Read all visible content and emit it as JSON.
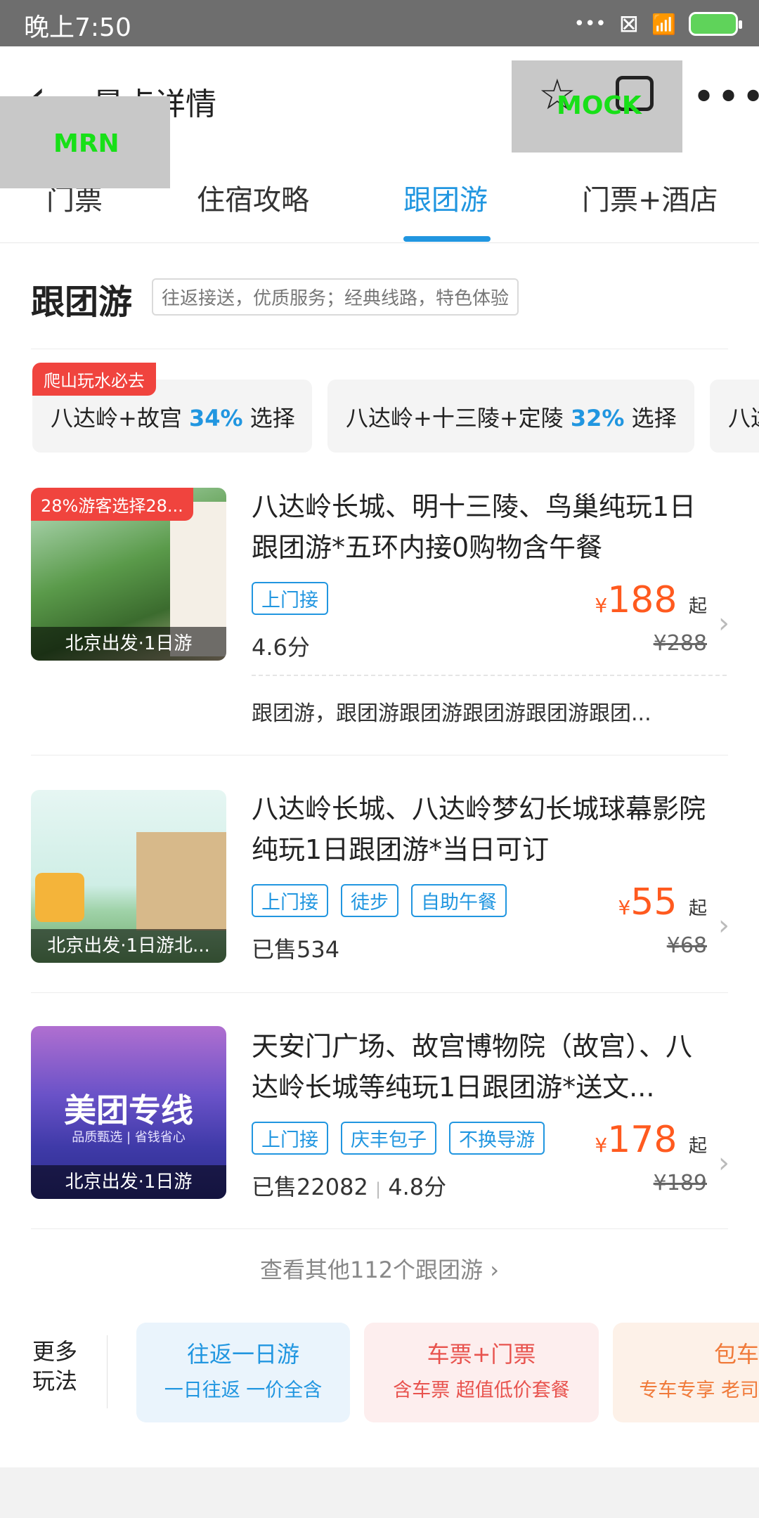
{
  "status_bar": {
    "time": "晚上7:50",
    "icons": [
      "dots-icon",
      "close-box-icon",
      "wifi-icon",
      "battery-charging-icon"
    ],
    "dots": "•••",
    "close": "⊠",
    "wifi": "📶"
  },
  "header": {
    "back_glyph": "‹",
    "title": "景点详情",
    "mock_label": "MOCK",
    "mrn_label": "MRN",
    "star_glyph": "☆",
    "more_glyph": "•••"
  },
  "tabs": [
    {
      "label": "门票"
    },
    {
      "label": "住宿攻略"
    },
    {
      "label": "跟团游",
      "active": true
    },
    {
      "label": "门票+酒店"
    }
  ],
  "section": {
    "title": "跟团游",
    "desc": "往返接送，优质服务；经典线路，特色体验"
  },
  "chips": [
    {
      "tag": "爬山玩水必去",
      "name": "八达岭+故宫",
      "pct": "34%",
      "suffix": "选择"
    },
    {
      "name": "八达岭+十三陵+定陵",
      "pct": "32%",
      "suffix": "选择"
    },
    {
      "name": "八达"
    }
  ],
  "products": [
    {
      "badge": "28%游客选择28...",
      "caption": "北京出发·1日游",
      "title": "八达岭长城、明十三陵、鸟巢纯玩1日跟团游*五环内接0购物含午餐",
      "tags": [
        "上门接"
      ],
      "meta": "4.6分",
      "price": "188",
      "old_price": "¥288",
      "desc": "跟团游，跟团游跟团游跟团游跟团游跟团..."
    },
    {
      "caption": "北京出发·1日游北...",
      "title": "八达岭长城、八达岭梦幻长城球幕影院纯玩1日跟团游*当日可订",
      "tags": [
        "上门接",
        "徒步",
        "自助午餐"
      ],
      "meta": "已售534",
      "price": "55",
      "old_price": "¥68"
    },
    {
      "caption": "北京出发·1日游",
      "thumb_title": "美团专线",
      "thumb_sub": "品质甄选 | 省钱省心",
      "title": "天安门广场、故宫博物院（故宫）、八达岭长城等纯玩1日跟团游*送文...",
      "tags": [
        "上门接",
        "庆丰包子",
        "不换导游"
      ],
      "meta_sold": "已售22082",
      "meta_sep": "|",
      "meta_score": "4.8分",
      "price": "178",
      "old_price": "¥189"
    }
  ],
  "price_prefix": "¥",
  "price_suffix": "起",
  "see_more": "查看其他112个跟团游 ›",
  "more_ways": {
    "title_line1": "更多",
    "title_line2": "玩法",
    "cards": [
      {
        "title": "往返一日游",
        "sub": "一日往返 一价全含",
        "bg": "#eaf4fc",
        "fg": "#2196e0"
      },
      {
        "title": "车票+门票",
        "sub": "含车票 超值低价套餐",
        "bg": "#fdeeee",
        "fg": "#e8534e"
      },
      {
        "title": "包车",
        "sub": "专车专享 老司",
        "bg": "#fdf1e8",
        "fg": "#f07a3a"
      }
    ]
  },
  "colors": {
    "accent": "#2196e0",
    "price": "#ff5a1f",
    "badge": "#f0443e"
  }
}
